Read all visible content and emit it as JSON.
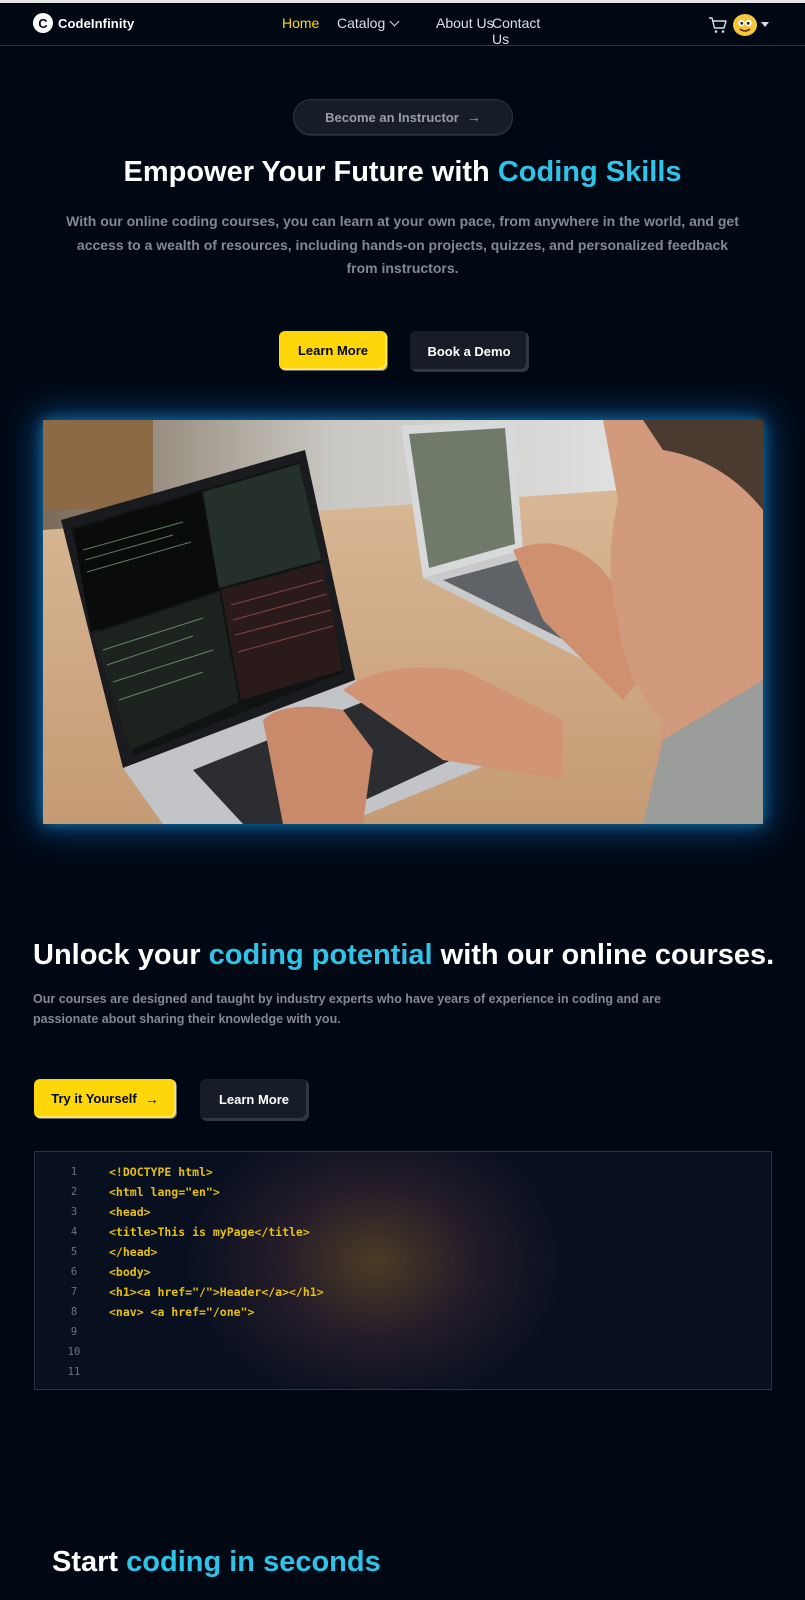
{
  "brand": {
    "name": "CodeInfinity",
    "mark": "C"
  },
  "nav": {
    "home": "Home",
    "catalog": "Catalog",
    "about": "About Us",
    "contact": "Contact Us"
  },
  "icons": {
    "cart": "cart-icon",
    "avatar": "avatar-icon",
    "arrow": "arrow-right-icon"
  },
  "colors": {
    "accent": "#ffd60a",
    "highlight": "#30c3e8",
    "background": "#000814",
    "panel": "#161d29"
  },
  "hero": {
    "instructor_button": "Become an Instructor",
    "title_prefix": "Empower Your Future with ",
    "title_highlight": "Coding Skills",
    "subtitle": "With our online coding courses, you can learn at your own pace, from anywhere in the world, and get access to a wealth of resources, including hands-on projects, quizzes, and personalized feedback from instructors.",
    "learn_more": "Learn More",
    "book_demo": "Book a Demo"
  },
  "section2": {
    "title_prefix": "Unlock your ",
    "title_highlight": "coding potential",
    "title_suffix": " with our online courses.",
    "subtitle": "Our courses are designed and taught by industry experts who have years of experience in coding and are passionate about sharing their knowledge with you.",
    "try_button": "Try it Yourself",
    "learn_more": "Learn More"
  },
  "code": {
    "line_numbers": [
      "1",
      "2",
      "3",
      "4",
      "5",
      "6",
      "7",
      "8",
      "9",
      "10",
      "11"
    ],
    "lines": [
      "<!DOCTYPE html>",
      "<html lang=\"en\">",
      "<head>",
      "<title>This is myPage</title>",
      "</head>",
      "<body>",
      "<h1><a href=\"/\">Header</a></h1>",
      "<nav> <a href=\"/one\">",
      "",
      "",
      ""
    ]
  },
  "section3": {
    "title_prefix": "Start ",
    "title_highlight": "coding in seconds"
  }
}
